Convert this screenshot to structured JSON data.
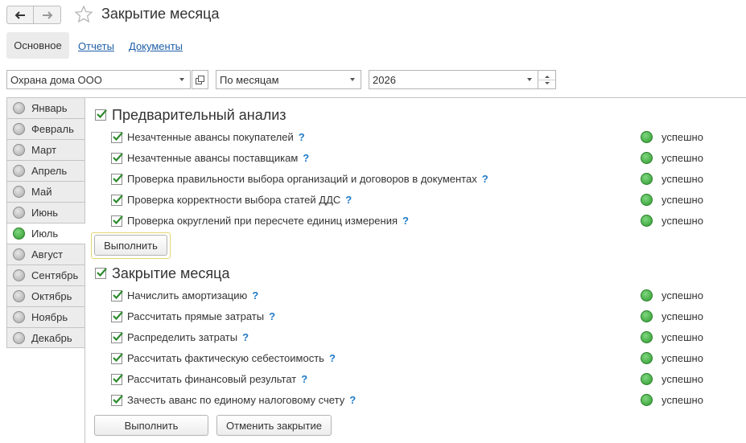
{
  "window": {
    "title": "Закрытие месяца"
  },
  "tabs": {
    "main": "Основное",
    "reports": "Отчеты",
    "documents": "Документы"
  },
  "filters": {
    "organization": "Охрана дома ООО",
    "period_type": "По месяцам",
    "year": "2026"
  },
  "months": [
    {
      "label": "Январь",
      "status": "gray"
    },
    {
      "label": "Февраль",
      "status": "gray"
    },
    {
      "label": "Март",
      "status": "gray"
    },
    {
      "label": "Апрель",
      "status": "gray"
    },
    {
      "label": "Май",
      "status": "gray"
    },
    {
      "label": "Июнь",
      "status": "gray"
    },
    {
      "label": "Июль",
      "status": "green",
      "selected": true
    },
    {
      "label": "Август",
      "status": "gray"
    },
    {
      "label": "Сентябрь",
      "status": "gray"
    },
    {
      "label": "Октябрь",
      "status": "gray"
    },
    {
      "label": "Ноябрь",
      "status": "gray"
    },
    {
      "label": "Декабрь",
      "status": "gray"
    }
  ],
  "preliminary": {
    "title": "Предварительный анализ",
    "checked": true,
    "items": [
      {
        "label": "Незачтенные авансы покупателей",
        "help": "?",
        "status": "успешно"
      },
      {
        "label": "Незачтенные авансы поставщикам",
        "help": "?",
        "status": "успешно"
      },
      {
        "label": "Проверка правильности выбора организаций и договоров в документах",
        "help": "?",
        "status": "успешно"
      },
      {
        "label": "Проверка корректности выбора статей ДДС",
        "help": "?",
        "status": "успешно"
      },
      {
        "label": "Проверка округлений при пересчете единиц измерения",
        "help": "?",
        "status": "успешно"
      }
    ],
    "run_button": "Выполнить"
  },
  "closing": {
    "title": "Закрытие месяца",
    "checked": true,
    "items": [
      {
        "label": "Начислить амортизацию",
        "help": "?",
        "status": "успешно"
      },
      {
        "label": "Рассчитать прямые затраты",
        "help": "?",
        "status": "успешно"
      },
      {
        "label": "Распределить затраты",
        "help": "?",
        "status": "успешно"
      },
      {
        "label": "Рассчитать фактическую себестоимость",
        "help": "?",
        "status": "успешно"
      },
      {
        "label": "Рассчитать финансовый результат",
        "help": "?",
        "status": "успешно"
      },
      {
        "label": "Зачесть аванс по единому налоговому счету",
        "help": "?",
        "status": "успешно"
      }
    ],
    "run_button": "Выполнить",
    "cancel_button": "Отменить закрытие"
  },
  "colors": {
    "success": "#3aa83a",
    "link": "#1f5fa8",
    "help": "#1f7ac7",
    "check": "#2e8b2e"
  }
}
